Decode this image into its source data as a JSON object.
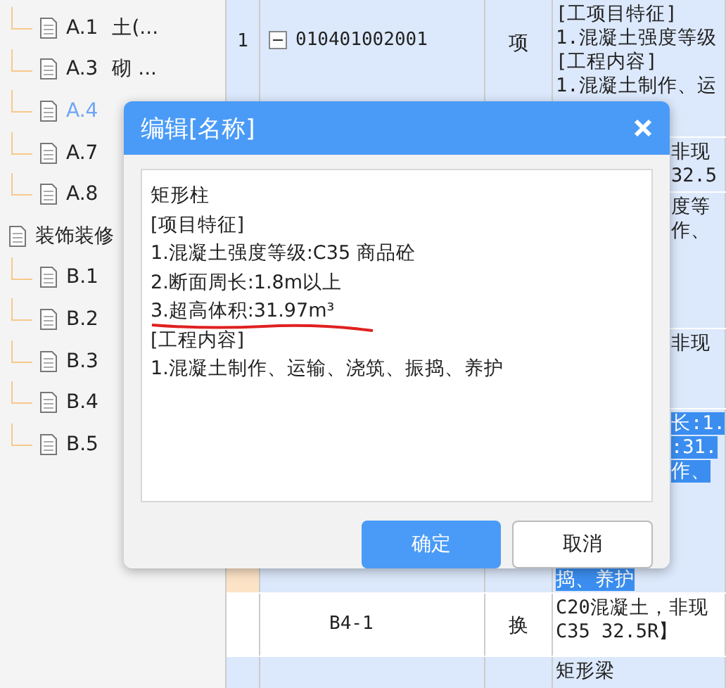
{
  "tree": [
    {
      "children": [
        {
          "code": "A.1",
          "name": "土(...",
          "selected": false
        },
        {
          "code": "A.3",
          "name": "砌 ...",
          "selected": false
        },
        {
          "code": "A.4",
          "selected": true
        },
        {
          "code": "A.7",
          "selected": false
        },
        {
          "code": "A.8",
          "selected": false
        }
      ]
    },
    {
      "label": "装饰装修",
      "children": [
        {
          "code": "B.1",
          "selected": false
        },
        {
          "code": "B.2",
          "selected": false
        },
        {
          "code": "B.3",
          "selected": false
        },
        {
          "code": "B.4",
          "selected": false
        },
        {
          "code": "B.5",
          "selected": false
        }
      ]
    }
  ],
  "table": {
    "rows": [
      {
        "number": "1",
        "code": "010401002001",
        "collapsible": true,
        "unit": "项",
        "selected": false,
        "content": [
          {
            "text": "[工项目特征]",
            "covered": false
          },
          {
            "text": "1.混凝土强度等级",
            "covered": false
          },
          {
            "text": "[工程内容]",
            "covered": false
          },
          {
            "text": "1.混凝土制作、运",
            "covered": false
          }
        ]
      },
      {
        "selected": false,
        "content": [
          {
            "text": "非现",
            "covered": true
          },
          {
            "text": "32.5",
            "covered": true
          }
        ]
      },
      {
        "selected": false,
        "content": [
          {
            "text": "度等",
            "covered": true
          },
          {
            "text": "作、",
            "covered": true
          }
        ]
      },
      {
        "selected": false,
        "content": [
          {
            "text": "非现",
            "covered": true
          }
        ]
      },
      {
        "selected": true,
        "content": [
          {
            "text": "长:1.",
            "covered": true
          },
          {
            "text": ":31.",
            "covered": true
          },
          {
            "text": "作、",
            "covered": true
          },
          {
            "text": "捣、养护",
            "covered": false
          }
        ]
      },
      {
        "code": "B4-1",
        "unit": "换",
        "selected": false,
        "white": true,
        "content": [
          {
            "text": "C20混凝土，非现",
            "covered": false
          },
          {
            "text": "C35 32.5R】",
            "covered": false
          }
        ]
      },
      {
        "selected": false,
        "content": [
          {
            "text": "矩形梁",
            "covered": false
          }
        ]
      }
    ]
  },
  "dialog": {
    "title": "编辑[名称]",
    "lines": [
      {
        "text": "矩形柱",
        "underlined": false
      },
      {
        "text": "[项目特征]",
        "underlined": false
      },
      {
        "text": "1.混凝土强度等级:C35 商品砼",
        "underlined": false
      },
      {
        "text": "2.断面周长:1.8m以上",
        "underlined": false
      },
      {
        "text": "3.超高体积:31.97m³",
        "underlined": true
      },
      {
        "text": "[工程内容]",
        "underlined": false
      },
      {
        "text": "1.混凝土制作、运输、浇筑、振捣、养护",
        "underlined": false
      }
    ],
    "buttons": [
      {
        "label": "确定",
        "primary": true
      },
      {
        "label": "取消",
        "primary": false
      }
    ]
  }
}
